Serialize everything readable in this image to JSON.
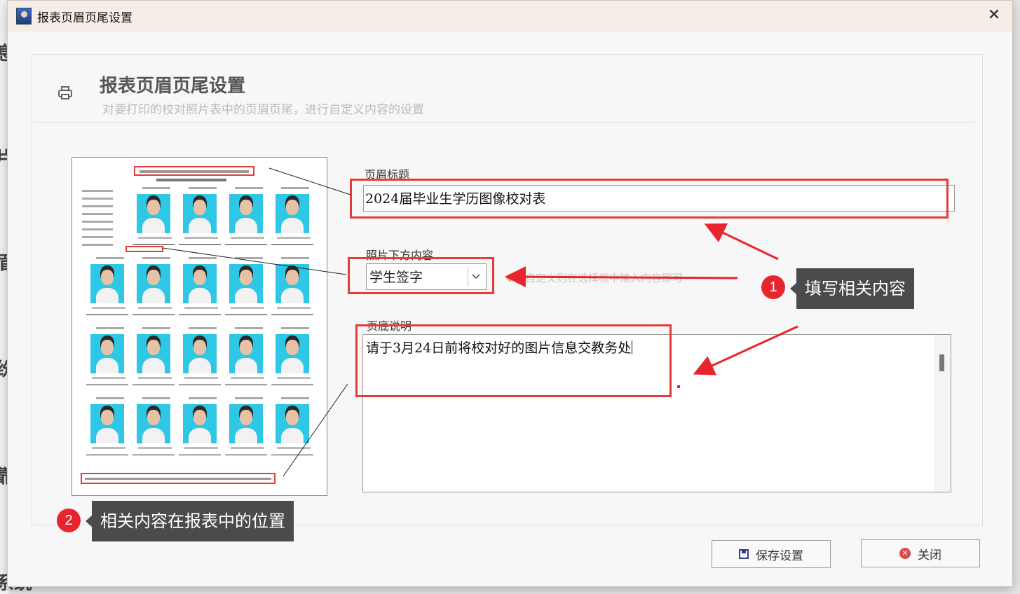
{
  "background": {
    "side_chars": [
      "息",
      "片",
      "眉",
      "纷",
      "靠",
      "系统"
    ]
  },
  "window": {
    "title": "报表页眉页尾设置",
    "close_glyph": "✕"
  },
  "header": {
    "title": "报表页眉页尾设置",
    "subtitle": "对要打印的校对照片表中的页眉页尾，进行自定义内容的设置"
  },
  "form": {
    "header_title_label": "页眉标题",
    "header_title_value": "2024届毕业生学历图像校对表",
    "photo_below_label": "照片下方内容",
    "photo_below_value": "学生签字",
    "photo_below_hint": "可自定义则在选择框中输入内容即可",
    "footer_label": "页底说明",
    "footer_value": "请于3月24日前将校对好的图片信息交教务处"
  },
  "annotations": {
    "badge1": "1",
    "callout1": "填写相关内容",
    "badge2": "2",
    "callout2": "相关内容在报表中的位置"
  },
  "buttons": {
    "save_label": "保存设置",
    "close_label": "关闭"
  },
  "colors": {
    "highlight_red": "#e43b3b",
    "callout_bg": "#4b4b4b",
    "preview_photo_bg": "#2ec7e5"
  }
}
